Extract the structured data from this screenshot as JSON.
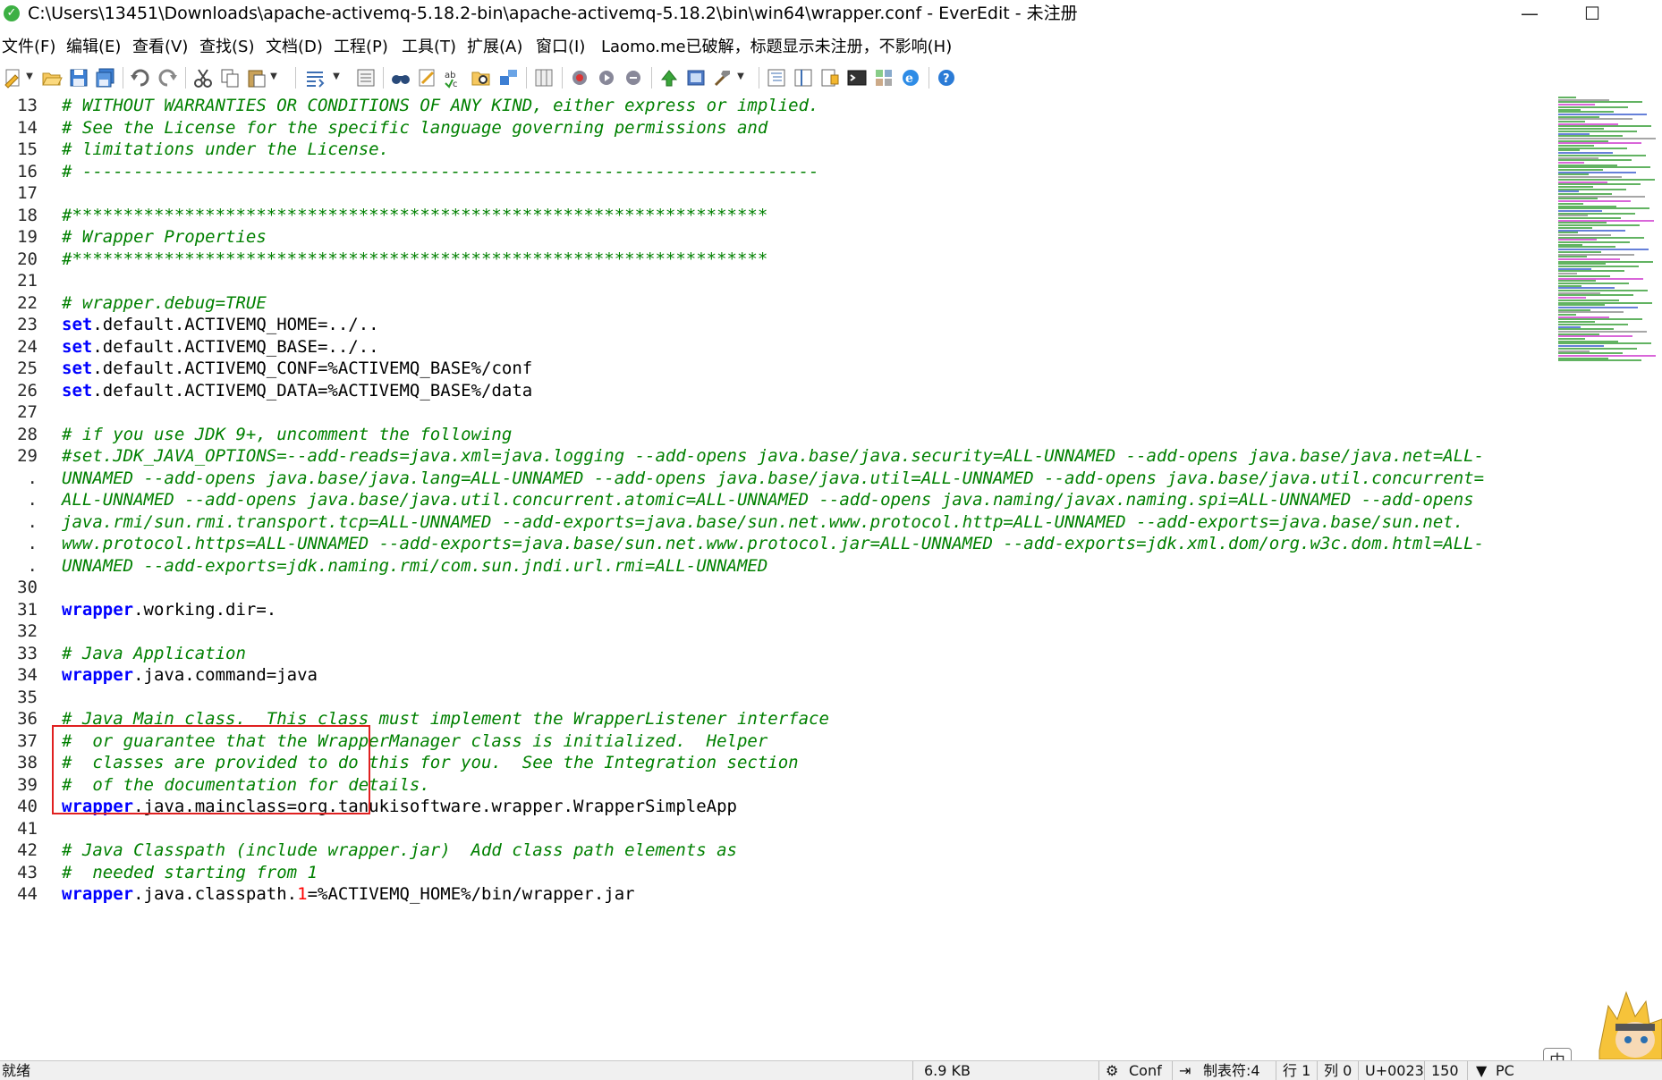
{
  "window": {
    "title": "C:\\Users\\13451\\Downloads\\apache-activemq-5.18.2-bin\\apache-activemq-5.18.2\\bin\\win64\\wrapper.conf - EverEdit - 未注册",
    "minimize_glyph": "—",
    "maximize_glyph": "☐",
    "app_icon": "everedit-app-icon",
    "app_icon_glyph": "✓"
  },
  "menu": [
    "文件(F)",
    "编辑(E)",
    "查看(V)",
    "查找(S)",
    "文档(D)",
    "工程(P)",
    "工具(T)",
    "扩展(A)",
    "窗口(I)",
    "Laomo.me已破解，标题显示未注册，不影响(H)"
  ],
  "toolbar": {
    "icons": [
      "new-file-icon",
      "open-file-icon",
      "save-icon",
      "save-all-icon",
      "undo-icon",
      "redo-icon",
      "cut-icon",
      "copy-icon",
      "paste-icon",
      "word-wrap-icon",
      "view-icon",
      "find-icon",
      "replace-icon",
      "spell-check-icon",
      "find-in-files-icon",
      "bookmark-icon",
      "column-icon",
      "macro-record-icon",
      "macro-play-icon",
      "macro-run-icon",
      "plugin-icon",
      "fullscreen-icon",
      "tools-icon",
      "outline-icon",
      "split-icon",
      "doc-map-icon",
      "console-icon",
      "snippet-icon",
      "browser-icon",
      "help-icon"
    ]
  },
  "editor": {
    "lines": [
      {
        "n": "13",
        "parts": [
          {
            "t": "# WITHOUT WARRANTIES OR CONDITIONS OF ANY KIND, either express or implied.",
            "c": "cm"
          }
        ]
      },
      {
        "n": "14",
        "parts": [
          {
            "t": "# See the License for the specific language governing permissions and",
            "c": "cm"
          }
        ]
      },
      {
        "n": "15",
        "parts": [
          {
            "t": "# limitations under the License.",
            "c": "cm"
          }
        ]
      },
      {
        "n": "16",
        "parts": [
          {
            "t": "# ------------------------------------------------------------------------",
            "c": "cm"
          }
        ]
      },
      {
        "n": "17",
        "parts": []
      },
      {
        "n": "18",
        "parts": [
          {
            "t": "#********************************************************************",
            "c": "cm"
          }
        ]
      },
      {
        "n": "19",
        "parts": [
          {
            "t": "# Wrapper Properties",
            "c": "cm"
          }
        ]
      },
      {
        "n": "20",
        "parts": [
          {
            "t": "#********************************************************************",
            "c": "cm"
          }
        ]
      },
      {
        "n": "21",
        "parts": []
      },
      {
        "n": "22",
        "parts": [
          {
            "t": "# wrapper.debug=TRUE",
            "c": "cm"
          }
        ]
      },
      {
        "n": "23",
        "parts": [
          {
            "t": "set",
            "c": "kw"
          },
          {
            "t": ".default.ACTIVEMQ_HOME=../..",
            "c": ""
          }
        ]
      },
      {
        "n": "24",
        "parts": [
          {
            "t": "set",
            "c": "kw"
          },
          {
            "t": ".default.ACTIVEMQ_BASE=../..",
            "c": ""
          }
        ]
      },
      {
        "n": "25",
        "parts": [
          {
            "t": "set",
            "c": "kw"
          },
          {
            "t": ".default.ACTIVEMQ_CONF=%ACTIVEMQ_BASE%/conf",
            "c": ""
          }
        ]
      },
      {
        "n": "26",
        "parts": [
          {
            "t": "set",
            "c": "kw"
          },
          {
            "t": ".default.ACTIVEMQ_DATA=%ACTIVEMQ_BASE%/data",
            "c": ""
          }
        ]
      },
      {
        "n": "27",
        "parts": []
      },
      {
        "n": "28",
        "parts": [
          {
            "t": "# if you use JDK 9+, uncomment the following",
            "c": "cm"
          }
        ]
      },
      {
        "n": "29",
        "parts": [
          {
            "t": "#set.JDK_JAVA_OPTIONS=--add-reads=java.xml=java.logging --add-opens java.base/java.security=ALL-UNNAMED --add-opens java.base/java.net=ALL-",
            "c": "cm"
          }
        ]
      },
      {
        "n": ".",
        "parts": [
          {
            "t": "UNNAMED --add-opens java.base/java.lang=ALL-UNNAMED --add-opens java.base/java.util=ALL-UNNAMED --add-opens java.base/java.util.concurrent=",
            "c": "cm"
          }
        ]
      },
      {
        "n": ".",
        "parts": [
          {
            "t": "ALL-UNNAMED --add-opens java.base/java.util.concurrent.atomic=ALL-UNNAMED --add-opens java.naming/javax.naming.spi=ALL-UNNAMED --add-opens",
            "c": "cm"
          }
        ]
      },
      {
        "n": ".",
        "parts": [
          {
            "t": "java.rmi/sun.rmi.transport.tcp=ALL-UNNAMED --add-exports=java.base/sun.net.www.protocol.http=ALL-UNNAMED --add-exports=java.base/sun.net.",
            "c": "cm"
          }
        ]
      },
      {
        "n": ".",
        "parts": [
          {
            "t": "www.protocol.https=ALL-UNNAMED --add-exports=java.base/sun.net.www.protocol.jar=ALL-UNNAMED --add-exports=jdk.xml.dom/org.w3c.dom.html=ALL-",
            "c": "cm"
          }
        ]
      },
      {
        "n": ".",
        "parts": [
          {
            "t": "UNNAMED --add-exports=jdk.naming.rmi/com.sun.jndi.url.rmi=ALL-UNNAMED",
            "c": "cm"
          }
        ]
      },
      {
        "n": "30",
        "parts": []
      },
      {
        "n": "31",
        "parts": [
          {
            "t": "wrapper",
            "c": "kw"
          },
          {
            "t": ".working.dir=.",
            "c": ""
          }
        ]
      },
      {
        "n": "32",
        "parts": []
      },
      {
        "n": "33",
        "parts": [
          {
            "t": "# Java Application",
            "c": "cm"
          }
        ]
      },
      {
        "n": "34",
        "parts": [
          {
            "t": "wrapper",
            "c": "kw"
          },
          {
            "t": ".java.command=java",
            "c": ""
          }
        ]
      },
      {
        "n": "35",
        "parts": []
      },
      {
        "n": "36",
        "parts": [
          {
            "t": "# Java Main class.  This class must implement the WrapperListener interface",
            "c": "cm"
          }
        ]
      },
      {
        "n": "37",
        "parts": [
          {
            "t": "#  or guarantee that the WrapperManager class is initialized.  Helper",
            "c": "cm"
          }
        ]
      },
      {
        "n": "38",
        "parts": [
          {
            "t": "#  classes are provided to do this for you.  See the Integration section",
            "c": "cm"
          }
        ]
      },
      {
        "n": "39",
        "parts": [
          {
            "t": "#  of the documentation for details.",
            "c": "cm"
          }
        ]
      },
      {
        "n": "40",
        "parts": [
          {
            "t": "wrapper",
            "c": "kw"
          },
          {
            "t": ".java.mainclass=org.tanukisoftware.wrapper.WrapperSimpleApp",
            "c": ""
          }
        ]
      },
      {
        "n": "41",
        "parts": []
      },
      {
        "n": "42",
        "parts": [
          {
            "t": "# Java Classpath (include wrapper.jar)  Add class path elements as",
            "c": "cm"
          }
        ]
      },
      {
        "n": "43",
        "parts": [
          {
            "t": "#  needed starting from 1",
            "c": "cm"
          }
        ]
      },
      {
        "n": "44",
        "parts": [
          {
            "t": "wrapper",
            "c": "kw"
          },
          {
            "t": ".java.classpath.",
            "c": ""
          },
          {
            "t": "1",
            "c": "num"
          },
          {
            "t": "=%ACTIVEMQ_HOME%/bin/wrapper.jar",
            "c": ""
          }
        ]
      }
    ]
  },
  "statusbar": {
    "ready": "就绪",
    "size": "6.9 KB",
    "mode": "Conf",
    "tab": "制表符:4",
    "line": "行 1",
    "col": "列 0",
    "code": "U+0023",
    "zoom": "150",
    "eol": "PC",
    "ime": "中"
  },
  "colors": {
    "comment": "#008000",
    "keyword": "#0000ff",
    "number": "#ff0000",
    "highlight_box": "#e02020"
  }
}
